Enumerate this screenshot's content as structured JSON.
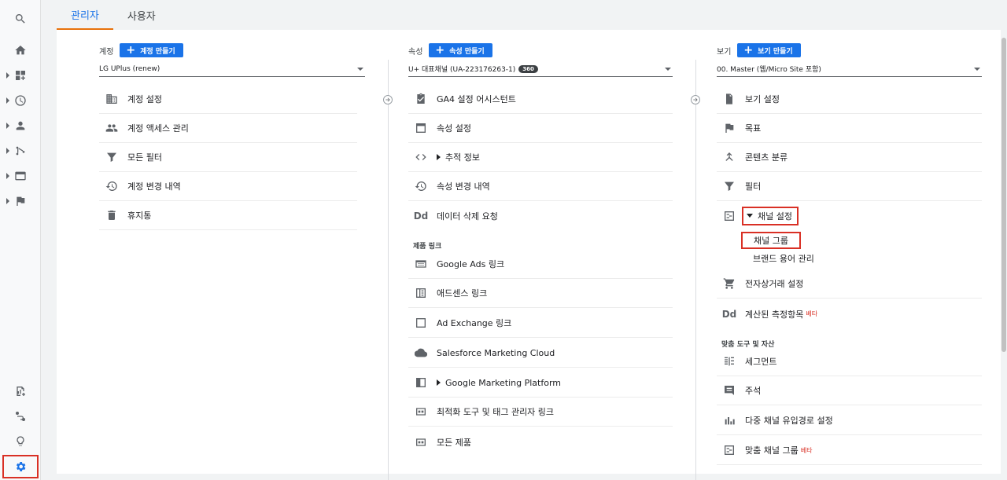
{
  "rail": {
    "items": [
      "search-icon",
      "home-icon",
      "dashboard-icon",
      "clock-icon",
      "person-icon",
      "acquisition-icon",
      "behavior-icon",
      "flag-icon",
      "report-add-icon",
      "path-icon",
      "lightbulb-icon",
      "gear-icon"
    ]
  },
  "tabs": [
    {
      "label": "관리자",
      "active": true
    },
    {
      "label": "사용자",
      "active": false
    }
  ],
  "account": {
    "label": "계정",
    "create": "계정 만들기",
    "selected": "LG UPlus (renew)",
    "items": [
      {
        "icon": "building-icon",
        "label": "계정 설정"
      },
      {
        "icon": "people-icon",
        "label": "계정 액세스 관리"
      },
      {
        "icon": "filter-icon",
        "label": "모든 필터"
      },
      {
        "icon": "history-icon",
        "label": "계정 변경 내역"
      },
      {
        "icon": "trash-icon",
        "label": "휴지통"
      }
    ]
  },
  "property": {
    "label": "속성",
    "create": "속성 만들기",
    "selected": "U+ 대표채널 (UA-223176263-1)",
    "badge": "360",
    "items": [
      {
        "icon": "checklist-icon",
        "label": "GA4 설정 어시스턴트"
      },
      {
        "icon": "window-icon",
        "label": "속성 설정"
      },
      {
        "icon": "code-icon",
        "label": "추적 정보"
      },
      {
        "icon": "history-icon",
        "label": "속성 변경 내역"
      },
      {
        "icon": "dd-icon",
        "label": "데이터 삭제 요청"
      }
    ],
    "dd": "Dd",
    "links_section": "제품 링크",
    "links": [
      {
        "icon": "ads-icon",
        "label": "Google Ads 링크"
      },
      {
        "icon": "adsense-icon",
        "label": "애드센스 링크"
      },
      {
        "icon": "window-icon",
        "label": "Ad Exchange 링크"
      },
      {
        "icon": "cloud-icon",
        "label": "Salesforce Marketing Cloud"
      },
      {
        "icon": "window-icon",
        "label": "Google Marketing Platform"
      },
      {
        "icon": "link-icon",
        "label": "최적화 도구 및 태그 관리자 링크"
      },
      {
        "icon": "link-icon",
        "label": "모든 제품"
      }
    ]
  },
  "view": {
    "label": "보기",
    "create": "보기 만들기",
    "selected": "00. Master (웹/Micro Site 포함)",
    "items": [
      {
        "icon": "doc-icon",
        "label": "보기 설정"
      },
      {
        "icon": "flag-icon",
        "label": "목표"
      },
      {
        "icon": "grouping-icon",
        "label": "콘텐츠 분류"
      },
      {
        "icon": "filter-icon",
        "label": "필터"
      }
    ],
    "channel_settings": "채널 설정",
    "channel_sub": [
      "채널 그룹",
      "브랜드 용어 관리"
    ],
    "ecommerce": "전자상거래 설정",
    "calculated": "계산된 측정항목",
    "beta": "베타",
    "dd": "Dd",
    "custom_section": "맞춤 도구 및 자산",
    "custom": [
      {
        "icon": "segment-icon",
        "label": "세그먼트"
      },
      {
        "icon": "comment-icon",
        "label": "주석"
      },
      {
        "icon": "bars-icon",
        "label": "다중 채널 유입경로 설정"
      },
      {
        "icon": "channel-icon",
        "label": "맞춤 채널 그룹"
      }
    ]
  }
}
